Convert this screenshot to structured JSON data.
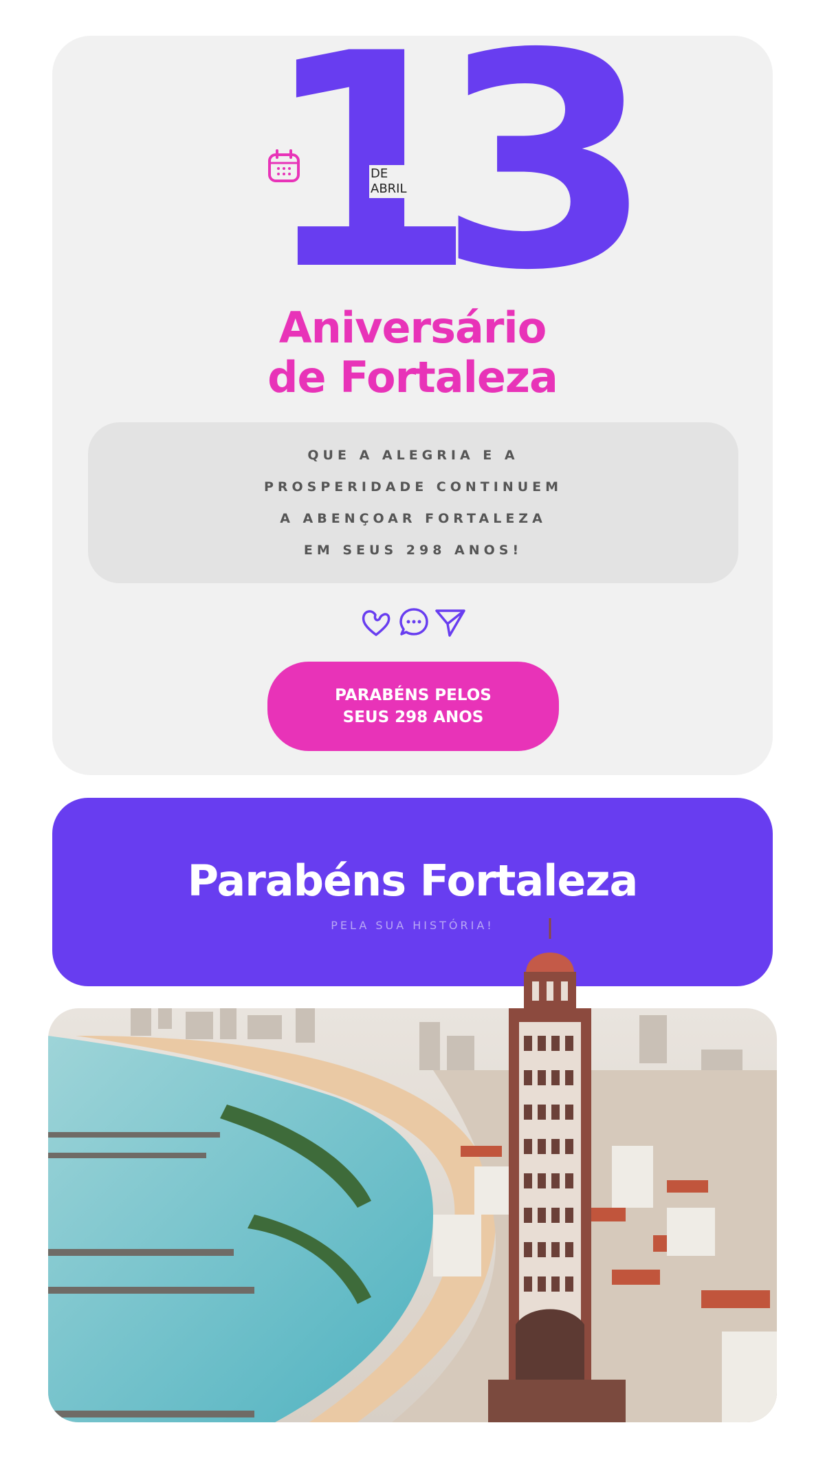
{
  "date": {
    "day": "13",
    "month_prefix": "DE",
    "month": "ABRIL",
    "icon": "calendar-icon"
  },
  "heading": {
    "line1": "Aniversário",
    "line2": "de Fortaleza"
  },
  "message": {
    "lines": [
      "QUE A ALEGRIA E A",
      "PROSPERIDADE CONTINUEM",
      "A ABENÇOAR FORTALEZA",
      "EM SEUS 298 ANOS!"
    ]
  },
  "social_icons": [
    "heart-icon",
    "chat-bubble-icon",
    "send-icon"
  ],
  "cta": {
    "line1": "PARABÉNS PELOS",
    "line2": "SEUS 298 ANOS"
  },
  "banner": {
    "title": "Parabéns Fortaleza",
    "subtitle": "PELA SUA HISTÓRIA!"
  },
  "colors": {
    "purple": "#683df0",
    "pink": "#e833b8",
    "card_bg": "#f1f1f1",
    "message_bg": "#e3e3e3"
  }
}
